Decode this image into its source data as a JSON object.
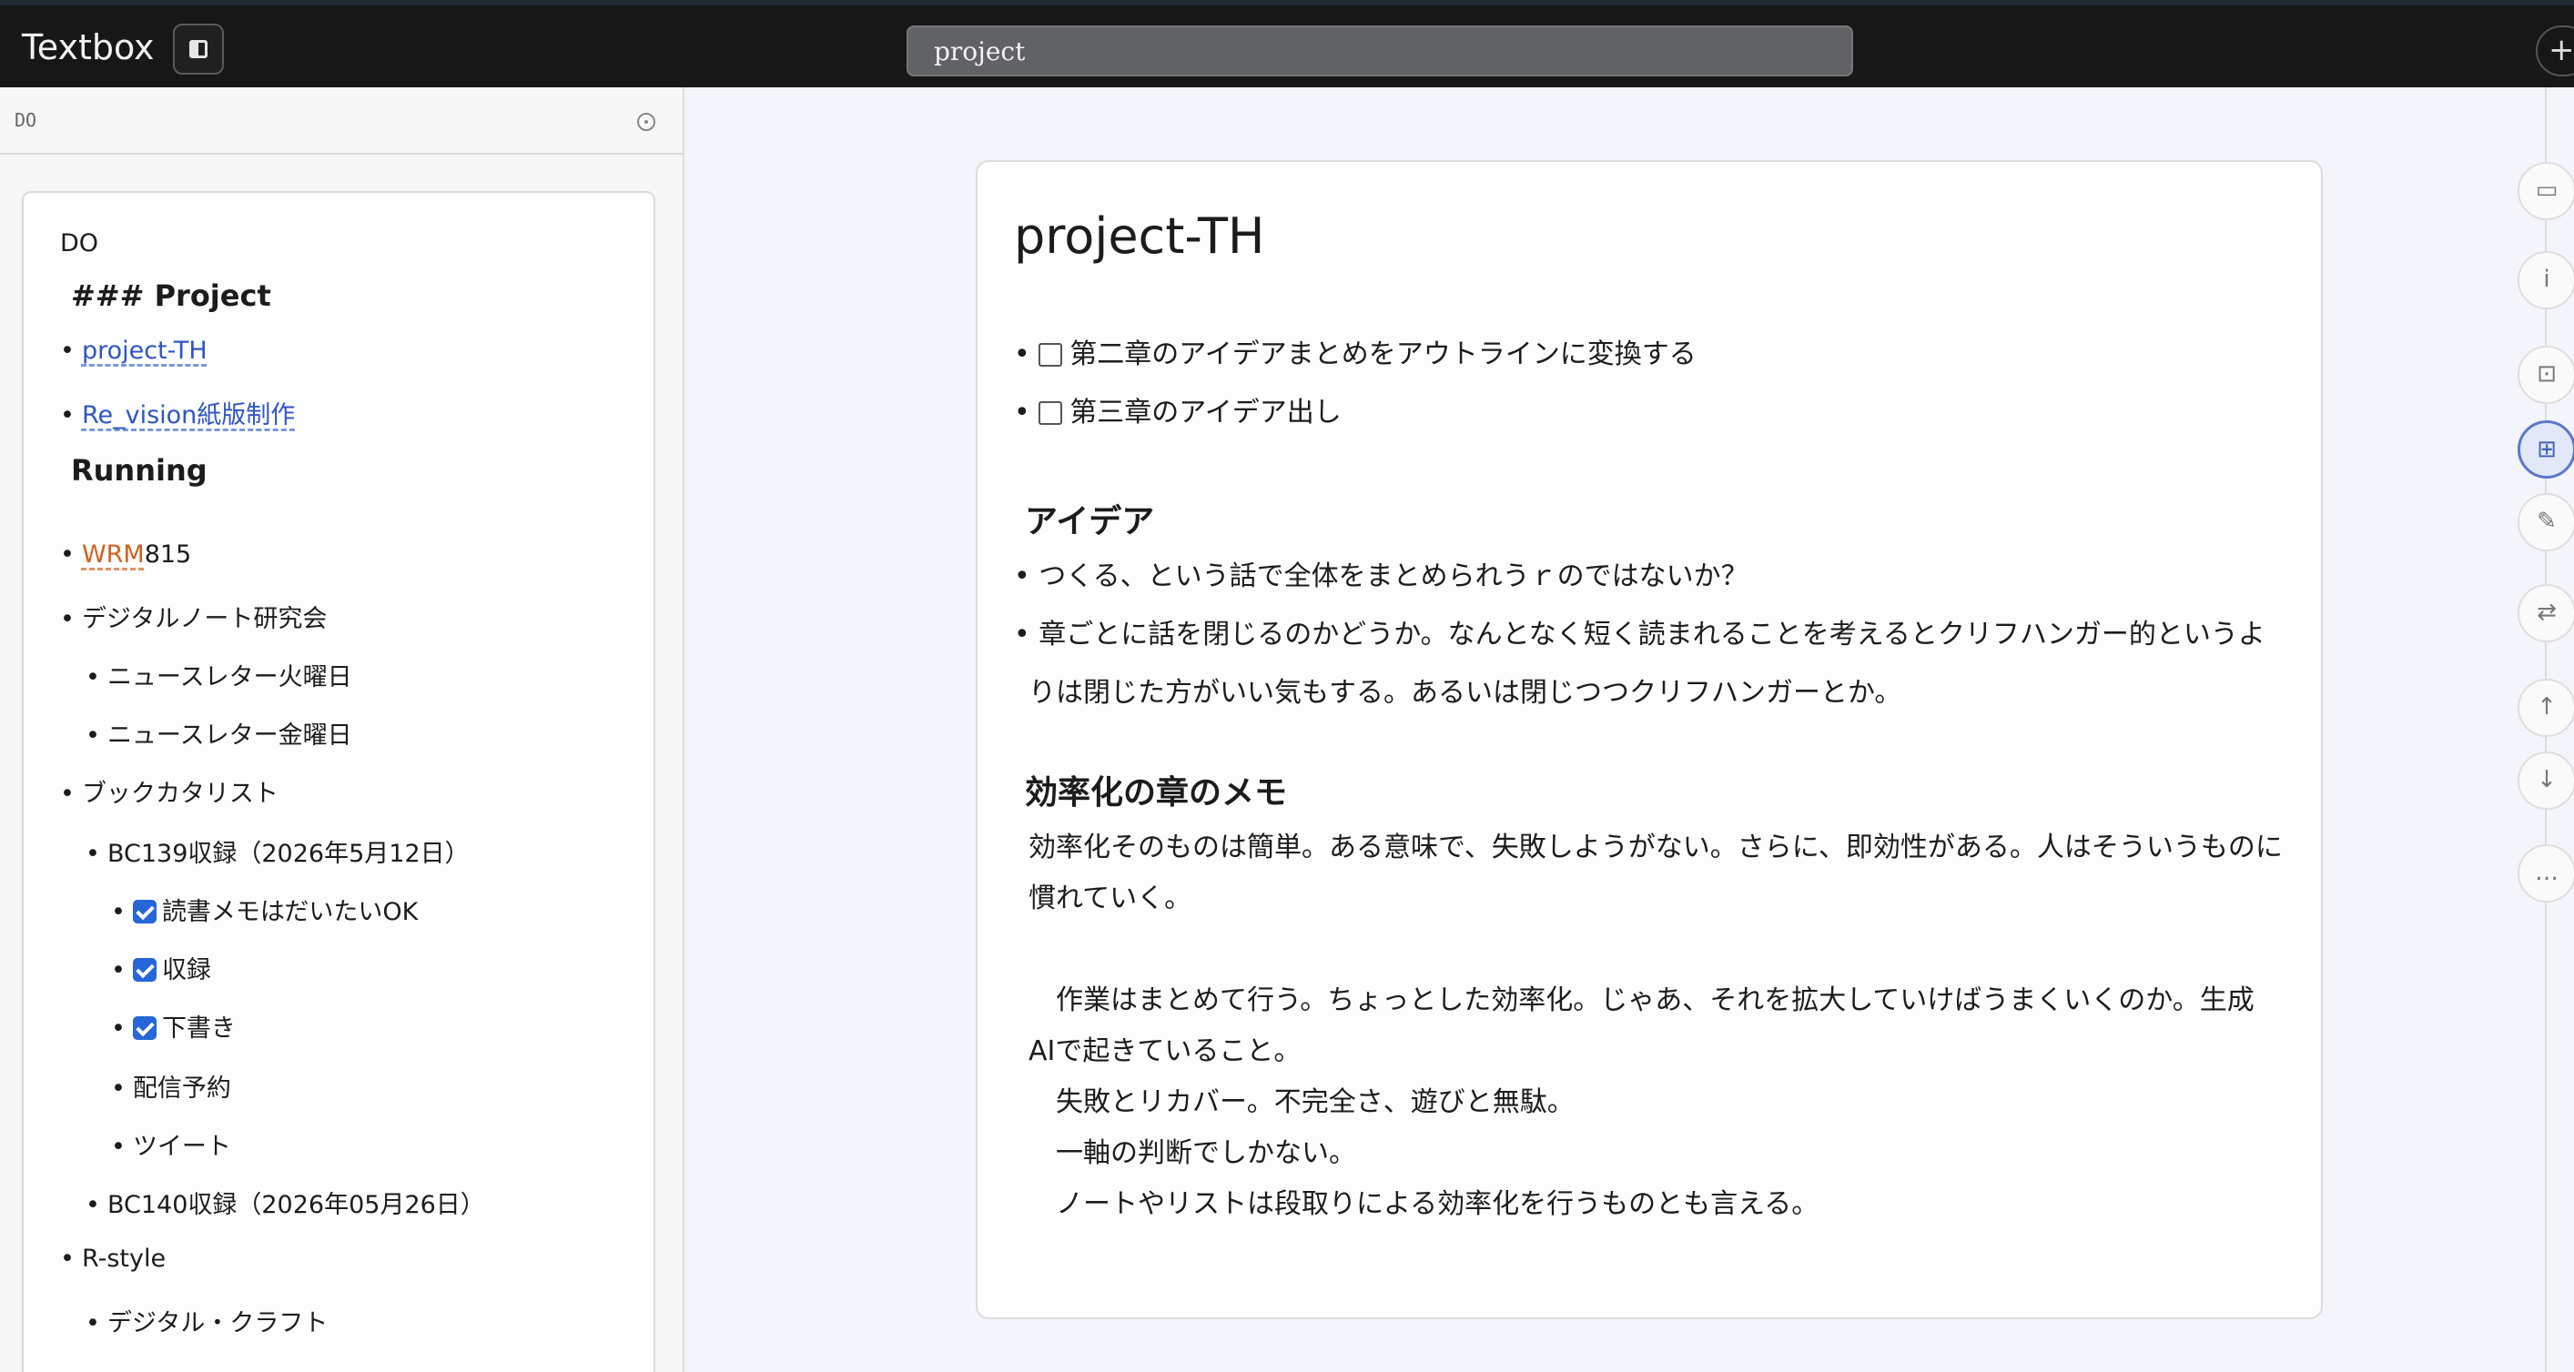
{
  "app": {
    "title": "Textbox",
    "search_value": "project",
    "add_label": "+"
  },
  "sidebar": {
    "header_label": "DO",
    "title": "DO",
    "items": [
      {
        "text": "### Project",
        "type": "heading"
      },
      {
        "text": "project-TH",
        "type": "link"
      },
      {
        "text": "Re_vision紙版制作",
        "type": "link"
      },
      {
        "text": "Running",
        "type": "heading"
      },
      {
        "link": "WRM",
        "text": "815",
        "type": "link-orange"
      },
      {
        "text": "デジタルノート研究会"
      },
      {
        "text": "ニュースレター火曜日"
      },
      {
        "text": "ニュースレター金曜日"
      },
      {
        "text": "ブックカタリスト"
      },
      {
        "text": "BC139収録（2026年5月12日）"
      },
      {
        "text": "読書メモはだいたいOK",
        "checked": true
      },
      {
        "text": "収録",
        "checked": true
      },
      {
        "text": "下書き",
        "checked": true
      },
      {
        "text": "配信予約"
      },
      {
        "text": "ツイート"
      },
      {
        "text": "BC140収録（2026年05月26日）"
      },
      {
        "text": "R-style"
      },
      {
        "text": "デジタル・クラフト"
      }
    ]
  },
  "document": {
    "title": "project-TH",
    "tasks": [
      {
        "text": "第二章のアイデアまとめをアウトラインに変換する",
        "checked": false
      },
      {
        "text": "第三章のアイデア出し",
        "checked": false
      }
    ],
    "section1": {
      "heading": "アイデア",
      "bullets": [
        "つくる、という話で全体をまとめられうｒのではないか？",
        "章ごとに話を閉じるのかどうか。なんとなく短く読まれることを考えるとクリフハンガー的というよ"
      ],
      "continuation": "りは閉じた方がいい気もする。あるいは閉じつつクリフハンガーとか。"
    },
    "section2": {
      "heading": "効率化の章のメモ",
      "para1_line1": "効率化そのものは簡単。ある意味で、失敗しようがない。さらに、即効性がある。人はそういうものに",
      "para1_line2": "慣れていく。",
      "para2_line1": "　作業はまとめて行う。ちょっとした効率化。じゃあ、それを拡大していけばうまくいくのか。生成",
      "para2_line2": "AIで起きていること。",
      "line3": "　失敗とリカバー。不完全さ、遊びと無駄。",
      "line4": "　一軸の判断でしかない。",
      "line5": "　ノートやリストは段取りによる効率化を行うものとも言える。"
    }
  },
  "rail": {
    "icons": [
      "archive-icon",
      "info-icon",
      "focus-icon",
      "grid-icon",
      "edit-icon",
      "swap-icon",
      "arrow-up-icon",
      "arrow-down-icon",
      "more-icon"
    ],
    "glyphs": [
      "▭",
      "i",
      "⊡",
      "⊞",
      "✎",
      "⇄",
      "↑",
      "↓",
      "…"
    ],
    "active_index": 3
  }
}
